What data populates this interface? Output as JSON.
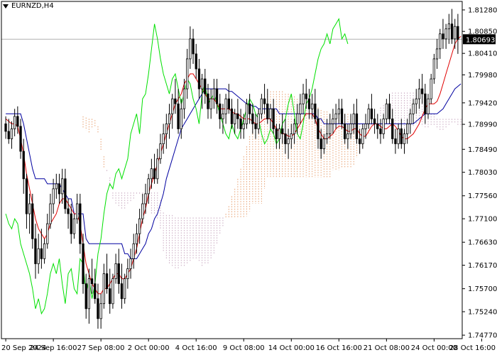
{
  "window": {
    "symbol_label": "EURNZD,H4"
  },
  "colors": {
    "background": "#ffffff",
    "candles": "#000000",
    "tenkan": "#e00000",
    "kijun": "#0000a0",
    "chikou": "#00e000",
    "cloud_bull": "#e8a070",
    "cloud_bear": "#c8a8c0",
    "price_line": "#b0b0b0",
    "price_box": "#000000"
  },
  "chart_data": {
    "type": "candlestick",
    "symbol": "EURNZD",
    "timeframe": "H4",
    "indicator": "Ichimoku Kinko Hyo",
    "current_price": "1.80693",
    "ylim": [
      1.747,
      1.8145
    ],
    "y_ticks": [
      "1.81280",
      "1.80850",
      "1.80410",
      "1.79980",
      "1.79420",
      "1.78990",
      "1.78490",
      "1.78030",
      "1.77560",
      "1.77100",
      "1.76630",
      "1.76170",
      "1.75700",
      "1.75240",
      "1.74770"
    ],
    "x_ticks": [
      "20 Sep 2024",
      "24 Sep 16:00",
      "27 Sep 08:00",
      "2 Oct 00:00",
      "4 Oct 16:00",
      "9 Oct 08:00",
      "14 Oct 00:00",
      "16 Oct 16:00",
      "21 Oct 08:00",
      "24 Oct 00:00",
      "28 Oct 16:00"
    ],
    "x_tick_bar_index": [
      0,
      16,
      32,
      48,
      64,
      80,
      96,
      112,
      128,
      144,
      160
    ],
    "candles": [
      [
        1.79,
        1.7915,
        1.787,
        1.7885
      ],
      [
        1.7885,
        1.791,
        1.786,
        1.787
      ],
      [
        1.787,
        1.7905,
        1.785,
        1.789
      ],
      [
        1.789,
        1.793,
        1.7875,
        1.7915
      ],
      [
        1.7915,
        1.7935,
        1.788,
        1.7895
      ],
      [
        1.7895,
        1.791,
        1.783,
        1.7845
      ],
      [
        1.7845,
        1.787,
        1.776,
        1.779
      ],
      [
        1.779,
        1.78,
        1.769,
        1.772
      ],
      [
        1.772,
        1.776,
        1.768,
        1.774
      ],
      [
        1.774,
        1.776,
        1.765,
        1.767
      ],
      [
        1.767,
        1.77,
        1.759,
        1.762
      ],
      [
        1.762,
        1.768,
        1.76,
        1.765
      ],
      [
        1.765,
        1.769,
        1.761,
        1.763
      ],
      [
        1.763,
        1.767,
        1.762,
        1.766
      ],
      [
        1.766,
        1.772,
        1.765,
        1.77
      ],
      [
        1.77,
        1.776,
        1.769,
        1.774
      ],
      [
        1.774,
        1.779,
        1.772,
        1.777
      ],
      [
        1.777,
        1.78,
        1.775,
        1.778
      ],
      [
        1.778,
        1.78,
        1.774,
        1.776
      ],
      [
        1.776,
        1.781,
        1.774,
        1.779
      ],
      [
        1.779,
        1.781,
        1.772,
        1.773
      ],
      [
        1.773,
        1.775,
        1.769,
        1.772
      ],
      [
        1.772,
        1.774,
        1.766,
        1.768
      ],
      [
        1.768,
        1.772,
        1.767,
        1.771
      ],
      [
        1.771,
        1.776,
        1.77,
        1.774
      ],
      [
        1.774,
        1.776,
        1.764,
        1.766
      ],
      [
        1.766,
        1.768,
        1.756,
        1.758
      ],
      [
        1.758,
        1.76,
        1.751,
        1.753
      ],
      [
        1.753,
        1.761,
        1.75,
        1.759
      ],
      [
        1.759,
        1.763,
        1.756,
        1.758
      ],
      [
        1.758,
        1.761,
        1.754,
        1.755
      ],
      [
        1.755,
        1.758,
        1.749,
        1.751
      ],
      [
        1.751,
        1.756,
        1.749,
        1.754
      ],
      [
        1.754,
        1.762,
        1.753,
        1.76
      ],
      [
        1.76,
        1.764,
        1.756,
        1.757
      ],
      [
        1.757,
        1.761,
        1.752,
        1.754
      ],
      [
        1.754,
        1.76,
        1.753,
        1.759
      ],
      [
        1.759,
        1.764,
        1.758,
        1.762
      ],
      [
        1.762,
        1.765,
        1.756,
        1.758
      ],
      [
        1.758,
        1.762,
        1.753,
        1.755
      ],
      [
        1.755,
        1.76,
        1.754,
        1.759
      ],
      [
        1.759,
        1.763,
        1.757,
        1.761
      ],
      [
        1.761,
        1.765,
        1.759,
        1.763
      ],
      [
        1.763,
        1.768,
        1.761,
        1.766
      ],
      [
        1.766,
        1.77,
        1.764,
        1.768
      ],
      [
        1.768,
        1.773,
        1.766,
        1.771
      ],
      [
        1.771,
        1.776,
        1.77,
        1.774
      ],
      [
        1.774,
        1.778,
        1.772,
        1.776
      ],
      [
        1.776,
        1.78,
        1.774,
        1.779
      ],
      [
        1.779,
        1.783,
        1.777,
        1.781
      ],
      [
        1.781,
        1.784,
        1.778,
        1.779
      ],
      [
        1.779,
        1.785,
        1.778,
        1.783
      ],
      [
        1.783,
        1.788,
        1.782,
        1.786
      ],
      [
        1.786,
        1.79,
        1.784,
        1.788
      ],
      [
        1.788,
        1.792,
        1.785,
        1.79
      ],
      [
        1.79,
        1.794,
        1.787,
        1.792
      ],
      [
        1.792,
        1.796,
        1.789,
        1.795
      ],
      [
        1.795,
        1.799,
        1.792,
        1.794
      ],
      [
        1.794,
        1.797,
        1.788,
        1.789
      ],
      [
        1.789,
        1.795,
        1.787,
        1.793
      ],
      [
        1.793,
        1.799,
        1.791,
        1.797
      ],
      [
        1.797,
        1.805,
        1.795,
        1.803
      ],
      [
        1.803,
        1.8095,
        1.801,
        1.807
      ],
      [
        1.807,
        1.809,
        1.802,
        1.804
      ],
      [
        1.804,
        1.806,
        1.799,
        1.801
      ],
      [
        1.801,
        1.803,
        1.795,
        1.797
      ],
      [
        1.797,
        1.8,
        1.793,
        1.799
      ],
      [
        1.799,
        1.801,
        1.794,
        1.796
      ],
      [
        1.796,
        1.798,
        1.791,
        1.793
      ],
      [
        1.793,
        1.797,
        1.791,
        1.795
      ],
      [
        1.795,
        1.799,
        1.793,
        1.797
      ],
      [
        1.797,
        1.799,
        1.792,
        1.794
      ],
      [
        1.794,
        1.796,
        1.789,
        1.791
      ],
      [
        1.791,
        1.794,
        1.788,
        1.792
      ],
      [
        1.792,
        1.796,
        1.79,
        1.795
      ],
      [
        1.795,
        1.798,
        1.792,
        1.793
      ],
      [
        1.793,
        1.795,
        1.789,
        1.79
      ],
      [
        1.79,
        1.793,
        1.788,
        1.792
      ],
      [
        1.792,
        1.795,
        1.789,
        1.791
      ],
      [
        1.791,
        1.793,
        1.787,
        1.789
      ],
      [
        1.789,
        1.792,
        1.787,
        1.79
      ],
      [
        1.79,
        1.795,
        1.789,
        1.794
      ],
      [
        1.794,
        1.796,
        1.79,
        1.792
      ],
      [
        1.792,
        1.794,
        1.788,
        1.79
      ],
      [
        1.79,
        1.792,
        1.787,
        1.789
      ],
      [
        1.789,
        1.793,
        1.788,
        1.792
      ],
      [
        1.792,
        1.796,
        1.791,
        1.795
      ],
      [
        1.795,
        1.798,
        1.792,
        1.794
      ],
      [
        1.794,
        1.797,
        1.79,
        1.791
      ],
      [
        1.791,
        1.794,
        1.789,
        1.793
      ],
      [
        1.793,
        1.795,
        1.788,
        1.789
      ],
      [
        1.789,
        1.79,
        1.785,
        1.787
      ],
      [
        1.787,
        1.79,
        1.785,
        1.789
      ],
      [
        1.789,
        1.792,
        1.786,
        1.788
      ],
      [
        1.788,
        1.791,
        1.784,
        1.786
      ],
      [
        1.786,
        1.789,
        1.783,
        1.787
      ],
      [
        1.787,
        1.79,
        1.785,
        1.788
      ],
      [
        1.788,
        1.791,
        1.786,
        1.79
      ],
      [
        1.79,
        1.794,
        1.788,
        1.792
      ],
      [
        1.792,
        1.796,
        1.79,
        1.794
      ],
      [
        1.794,
        1.798,
        1.792,
        1.796
      ],
      [
        1.796,
        1.799,
        1.793,
        1.795
      ],
      [
        1.795,
        1.797,
        1.791,
        1.793
      ],
      [
        1.793,
        1.796,
        1.791,
        1.794
      ],
      [
        1.794,
        1.797,
        1.79,
        1.791
      ],
      [
        1.791,
        1.793,
        1.785,
        1.787
      ],
      [
        1.787,
        1.789,
        1.783,
        1.785
      ],
      [
        1.785,
        1.788,
        1.784,
        1.787
      ],
      [
        1.787,
        1.791,
        1.786,
        1.788
      ],
      [
        1.788,
        1.792,
        1.787,
        1.79
      ],
      [
        1.79,
        1.793,
        1.788,
        1.791
      ],
      [
        1.791,
        1.794,
        1.789,
        1.792
      ],
      [
        1.792,
        1.795,
        1.79,
        1.793
      ],
      [
        1.793,
        1.795,
        1.789,
        1.79
      ],
      [
        1.79,
        1.792,
        1.786,
        1.787
      ],
      [
        1.787,
        1.79,
        1.785,
        1.788
      ],
      [
        1.788,
        1.792,
        1.787,
        1.79
      ],
      [
        1.79,
        1.794,
        1.788,
        1.792
      ],
      [
        1.792,
        1.795,
        1.786,
        1.787
      ],
      [
        1.787,
        1.789,
        1.784,
        1.786
      ],
      [
        1.786,
        1.79,
        1.785,
        1.789
      ],
      [
        1.789,
        1.792,
        1.787,
        1.79
      ],
      [
        1.79,
        1.794,
        1.789,
        1.793
      ],
      [
        1.793,
        1.796,
        1.79,
        1.791
      ],
      [
        1.791,
        1.793,
        1.788,
        1.79
      ],
      [
        1.79,
        1.792,
        1.787,
        1.789
      ],
      [
        1.789,
        1.791,
        1.786,
        1.788
      ],
      [
        1.788,
        1.792,
        1.787,
        1.791
      ],
      [
        1.791,
        1.795,
        1.79,
        1.794
      ],
      [
        1.794,
        1.796,
        1.79,
        1.791
      ],
      [
        1.791,
        1.793,
        1.786,
        1.787
      ],
      [
        1.787,
        1.789,
        1.784,
        1.786
      ],
      [
        1.786,
        1.79,
        1.785,
        1.789
      ],
      [
        1.789,
        1.791,
        1.785,
        1.786
      ],
      [
        1.786,
        1.789,
        1.784,
        1.788
      ],
      [
        1.788,
        1.791,
        1.786,
        1.79
      ],
      [
        1.79,
        1.793,
        1.788,
        1.792
      ],
      [
        1.792,
        1.795,
        1.79,
        1.794
      ],
      [
        1.794,
        1.797,
        1.792,
        1.795
      ],
      [
        1.795,
        1.799,
        1.793,
        1.797
      ],
      [
        1.797,
        1.8,
        1.794,
        1.796
      ],
      [
        1.796,
        1.798,
        1.79,
        1.792
      ],
      [
        1.792,
        1.796,
        1.791,
        1.795
      ],
      [
        1.795,
        1.8,
        1.794,
        1.799
      ],
      [
        1.799,
        1.804,
        1.798,
        1.803
      ],
      [
        1.803,
        1.807,
        1.801,
        1.805
      ],
      [
        1.805,
        1.809,
        1.803,
        1.808
      ],
      [
        1.808,
        1.811,
        1.805,
        1.807
      ],
      [
        1.807,
        1.81,
        1.805,
        1.809
      ],
      [
        1.809,
        1.812,
        1.806,
        1.81
      ],
      [
        1.81,
        1.813,
        1.806,
        1.807
      ],
      [
        1.807,
        1.811,
        1.805,
        1.8095
      ],
      [
        1.8095,
        1.812,
        1.804,
        1.8069
      ]
    ],
    "tenkan": [
      1.791,
      1.7905,
      1.79,
      1.79,
      1.7895,
      1.787,
      1.784,
      1.78,
      1.777,
      1.774,
      1.771,
      1.769,
      1.768,
      1.767,
      1.768,
      1.77,
      1.771,
      1.772,
      1.774,
      1.775,
      1.775,
      1.774,
      1.773,
      1.772,
      1.772,
      1.77,
      1.766,
      1.762,
      1.76,
      1.758,
      1.757,
      1.756,
      1.756,
      1.757,
      1.757,
      1.758,
      1.759,
      1.76,
      1.76,
      1.759,
      1.759,
      1.76,
      1.761,
      1.763,
      1.765,
      1.768,
      1.771,
      1.773,
      1.776,
      1.778,
      1.78,
      1.782,
      1.784,
      1.786,
      1.788,
      1.79,
      1.792,
      1.794,
      1.795,
      1.796,
      1.798,
      1.799,
      1.8,
      1.8,
      1.799,
      1.798,
      1.797,
      1.796,
      1.795,
      1.795,
      1.795,
      1.794,
      1.793,
      1.793,
      1.793,
      1.793,
      1.7925,
      1.792,
      1.792,
      1.7915,
      1.791,
      1.791,
      1.791,
      1.7905,
      1.79,
      1.79,
      1.7905,
      1.791,
      1.791,
      1.791,
      1.79,
      1.789,
      1.7885,
      1.788,
      1.788,
      1.7875,
      1.7875,
      1.788,
      1.789,
      1.79,
      1.791,
      1.792,
      1.792,
      1.792,
      1.791,
      1.789,
      1.788,
      1.787,
      1.787,
      1.7875,
      1.788,
      1.789,
      1.7895,
      1.7895,
      1.789,
      1.7885,
      1.7885,
      1.789,
      1.789,
      1.788,
      1.7875,
      1.7875,
      1.7885,
      1.7895,
      1.79,
      1.79,
      1.7895,
      1.789,
      1.789,
      1.7895,
      1.79,
      1.7895,
      1.7885,
      1.7875,
      1.787,
      1.787,
      1.7875,
      1.788,
      1.789,
      1.79,
      1.7915,
      1.793,
      1.794,
      1.794,
      1.794,
      1.7945,
      1.796,
      1.798,
      1.8,
      1.802,
      1.804,
      1.806,
      1.807,
      1.8075,
      1.808,
      1.808,
      1.8075
    ],
    "kijun": [
      1.792,
      1.792,
      1.792,
      1.792,
      1.792,
      1.792,
      1.79,
      1.787,
      1.784,
      1.781,
      1.779,
      1.779,
      1.779,
      1.779,
      1.778,
      1.778,
      1.778,
      1.778,
      1.778,
      1.777,
      1.776,
      1.775,
      1.775,
      1.772,
      1.772,
      1.772,
      1.772,
      1.767,
      1.766,
      1.766,
      1.766,
      1.766,
      1.766,
      1.766,
      1.766,
      1.766,
      1.766,
      1.766,
      1.766,
      1.766,
      1.764,
      1.764,
      1.763,
      1.763,
      1.763,
      1.764,
      1.765,
      1.766,
      1.768,
      1.769,
      1.771,
      1.772,
      1.774,
      1.776,
      1.779,
      1.781,
      1.783,
      1.785,
      1.787,
      1.789,
      1.79,
      1.791,
      1.792,
      1.793,
      1.794,
      1.795,
      1.796,
      1.797,
      1.797,
      1.797,
      1.797,
      1.797,
      1.797,
      1.797,
      1.797,
      1.7965,
      1.7965,
      1.796,
      1.7955,
      1.795,
      1.7945,
      1.794,
      1.794,
      1.7935,
      1.7935,
      1.793,
      1.793,
      1.793,
      1.793,
      1.793,
      1.793,
      1.793,
      1.792,
      1.792,
      1.792,
      1.792,
      1.792,
      1.792,
      1.792,
      1.792,
      1.792,
      1.792,
      1.792,
      1.792,
      1.792,
      1.791,
      1.791,
      1.79,
      1.79,
      1.79,
      1.79,
      1.79,
      1.79,
      1.79,
      1.79,
      1.79,
      1.79,
      1.79,
      1.79,
      1.79,
      1.79,
      1.79,
      1.79,
      1.79,
      1.79,
      1.79,
      1.79,
      1.79,
      1.79,
      1.79,
      1.79,
      1.79,
      1.79,
      1.79,
      1.79,
      1.79,
      1.79,
      1.79,
      1.7905,
      1.791,
      1.7915,
      1.792,
      1.792,
      1.792,
      1.792,
      1.792,
      1.7925,
      1.793,
      1.794,
      1.795,
      1.796,
      1.797,
      1.7975,
      1.798,
      1.798,
      1.798,
      1.798
    ],
    "chikou": [
      1.772,
      1.77,
      1.769,
      1.771,
      1.77,
      1.766,
      1.764,
      1.762,
      1.76,
      1.757,
      1.753,
      1.755,
      1.752,
      1.753,
      1.756,
      1.76,
      1.762,
      1.76,
      1.763,
      1.758,
      1.754,
      1.76,
      1.761,
      1.757,
      1.756,
      1.763,
      1.762,
      1.756,
      1.759,
      1.755,
      1.758,
      1.764,
      1.767,
      1.772,
      1.776,
      1.778,
      1.777,
      1.78,
      1.781,
      1.779,
      1.781,
      1.783,
      1.788,
      1.79,
      1.792,
      1.788,
      1.795,
      1.796,
      1.8,
      1.805,
      1.81,
      1.807,
      1.803,
      1.8,
      1.798,
      1.796,
      1.799,
      1.8,
      1.797,
      1.794,
      1.796,
      1.799,
      1.798,
      1.795,
      1.793,
      1.79,
      1.796,
      1.798,
      1.794,
      1.795,
      1.796,
      1.794,
      1.792,
      1.79,
      1.788,
      1.787,
      1.79,
      1.788,
      1.787,
      1.789,
      1.791,
      1.793,
      1.795,
      1.794,
      1.792,
      1.791,
      1.788,
      1.786,
      1.787,
      1.789,
      1.788,
      1.786,
      1.787,
      1.79,
      1.791,
      1.794,
      1.796,
      1.792,
      1.788,
      1.787,
      1.79,
      1.794,
      1.795,
      1.797,
      1.8,
      1.803,
      1.805,
      1.806,
      1.808,
      1.806,
      1.809,
      1.81,
      1.811,
      1.807,
      1.808,
      1.806
    ]
  }
}
